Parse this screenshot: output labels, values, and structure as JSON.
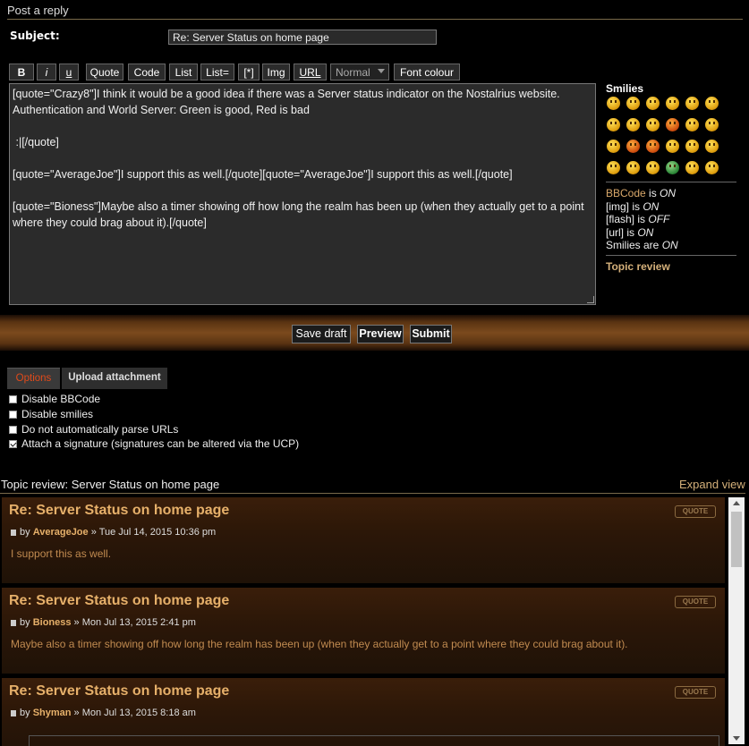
{
  "header": {
    "title": "Post a reply"
  },
  "subject": {
    "label": "Subject:",
    "value": "Re: Server Status on home page"
  },
  "toolbar": {
    "bold": "B",
    "italic": "i",
    "underline": "u",
    "quote": "Quote",
    "code": "Code",
    "list": "List",
    "list_eq": "List=",
    "list_item": "[*]",
    "img": "Img",
    "url": "URL",
    "font_size": "Normal",
    "font_colour": "Font colour"
  },
  "message": {
    "lines": [
      "[quote=\"Crazy8\"]I think it would be a good idea if there was a Server status indicator on the Nostalrius website. Authentication and World Server: Green is good, Red is bad",
      " :|[/quote]",
      "[quote=\"AverageJoe\"]I support this as well.[/quote][quote=\"AverageJoe\"]I support this as well.[/quote]",
      "[quote=\"Bioness\"]Maybe also a timer showing off how long the realm has been up (when they actually get to a point where they could brag about it).[/quote]"
    ]
  },
  "sidebar": {
    "smilies_heading": "Smilies",
    "smilies": [
      "very-happy-icon",
      "smile-icon",
      "wink-icon",
      "sad-icon",
      "surprised-icon",
      "shocked-icon",
      "confused-icon",
      "cool-icon",
      "laughing-icon",
      "mad-icon",
      "razz-icon",
      "embarrassed-icon",
      "crying-icon",
      "evil-icon",
      "twisted-evil-icon",
      "rolling-eyes-icon",
      "exclamation-icon",
      "question-icon",
      "idea-icon",
      "arrow-icon",
      "neutral-icon",
      "mr-green-icon",
      "geek-icon",
      "uber-geek-icon"
    ],
    "status": {
      "bbcode_link": "BBCode",
      "bbcode_is": " is ",
      "bbcode_state": "ON",
      "img_label": "[img] is ",
      "img_state": "ON",
      "flash_label": "[flash] is ",
      "flash_state": "OFF",
      "url_label": "[url] is ",
      "url_state": "ON",
      "smilies_label": "Smilies are ",
      "smilies_state": "ON"
    },
    "topic_review_link": "Topic review"
  },
  "actions": {
    "save_draft": "Save draft",
    "preview": "Preview",
    "submit": "Submit"
  },
  "tabs": {
    "options": "Options",
    "upload": "Upload attachment"
  },
  "options": [
    {
      "label": "Disable BBCode",
      "checked": false
    },
    {
      "label": "Disable smilies",
      "checked": false
    },
    {
      "label": "Do not automatically parse URLs",
      "checked": false
    },
    {
      "label": "Attach a signature (signatures can be altered via the UCP)",
      "checked": true
    }
  ],
  "review": {
    "title": "Topic review: Server Status on home page",
    "expand": "Expand view",
    "quote_label": "QUOTE",
    "posts": [
      {
        "title": "Re: Server Status on home page",
        "by": "by ",
        "author": "AverageJoe",
        "date": " » Tue Jul 14, 2015 10:36 pm",
        "body": "I support this as well."
      },
      {
        "title": "Re: Server Status on home page",
        "by": "by ",
        "author": "Bioness",
        "date": " » Mon Jul 13, 2015 2:41 pm",
        "body": "Maybe also a timer showing off how long the realm has been up (when they actually get to a point where they could brag about it)."
      },
      {
        "title": "Re: Server Status on home page",
        "by": "by ",
        "author": "Shyman",
        "date": " » Mon Jul 13, 2015 8:18 am",
        "body": ""
      }
    ]
  }
}
